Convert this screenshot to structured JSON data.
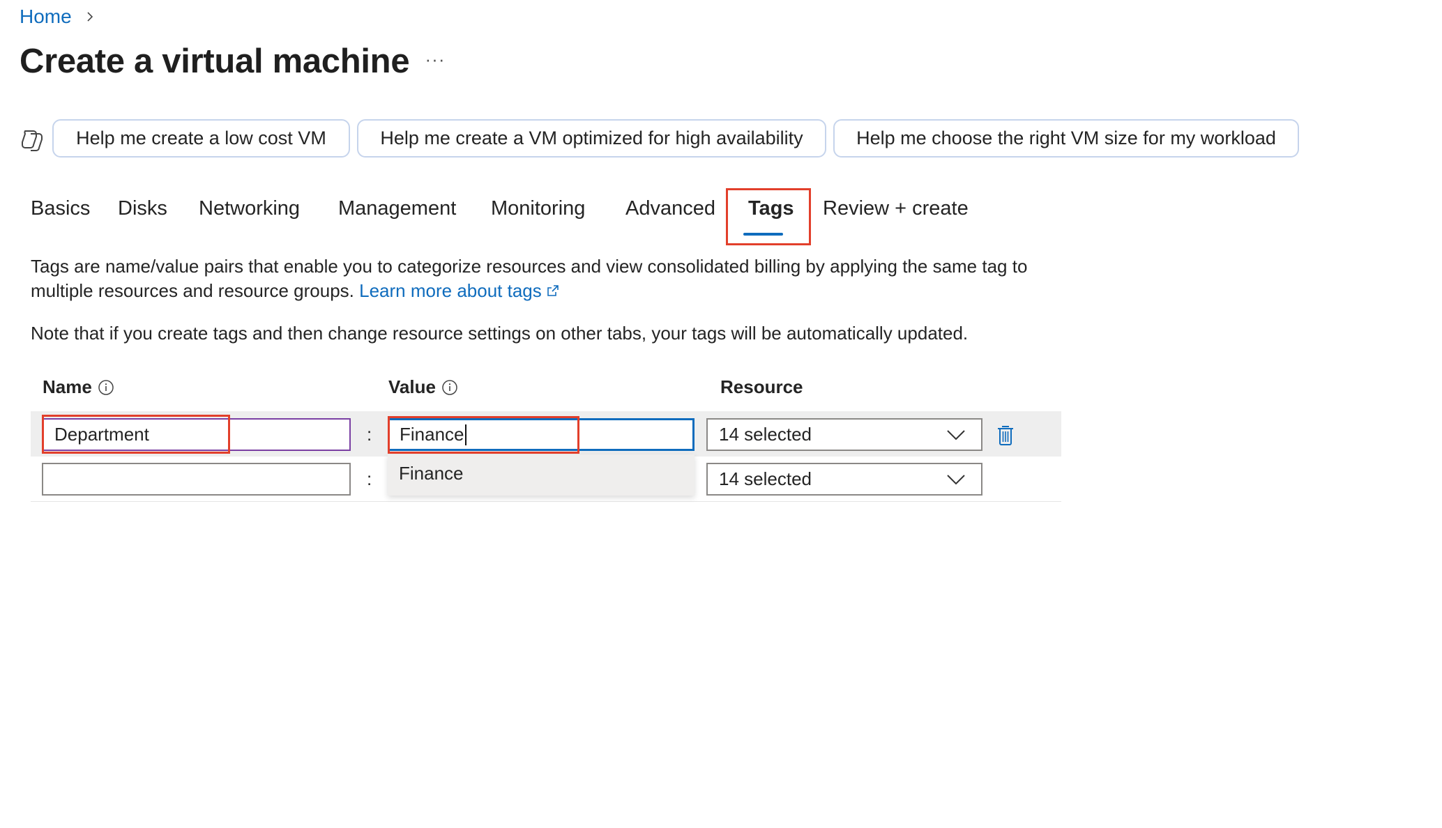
{
  "breadcrumb": {
    "home": "Home"
  },
  "page": {
    "title": "Create a virtual machine",
    "more": "···"
  },
  "copilot": {
    "suggestions": [
      "Help me create a low cost VM",
      "Help me create a VM optimized for high availability",
      "Help me choose the right VM size for my workload"
    ]
  },
  "tabs": [
    "Basics",
    "Disks",
    "Networking",
    "Management",
    "Monitoring",
    "Advanced",
    "Tags",
    "Review + create"
  ],
  "active_tab": "Tags",
  "intro": {
    "text": "Tags are name/value pairs that enable you to categorize resources and view consolidated billing by applying the same tag to multiple resources and resource groups.",
    "link": "Learn more about tags",
    "note": "Note that if you create tags and then change resource settings on other tabs, your tags will be automatically updated."
  },
  "table": {
    "headers": {
      "name": "Name",
      "value": "Value",
      "resource": "Resource"
    },
    "separator": ":",
    "rows": [
      {
        "name": "Department",
        "value": "Finance",
        "resource": "14 selected"
      },
      {
        "name": "",
        "value": "",
        "resource": "14 selected"
      }
    ],
    "value_suggestion": "Finance"
  },
  "colors": {
    "accent": "#0f6cbd",
    "highlight": "#e23f2b",
    "row_bg": "#eeeeee"
  },
  "icons": [
    "chevron-right-icon",
    "copilot-icon",
    "info-icon",
    "external-link-icon",
    "chevron-down-icon",
    "delete-icon"
  ]
}
